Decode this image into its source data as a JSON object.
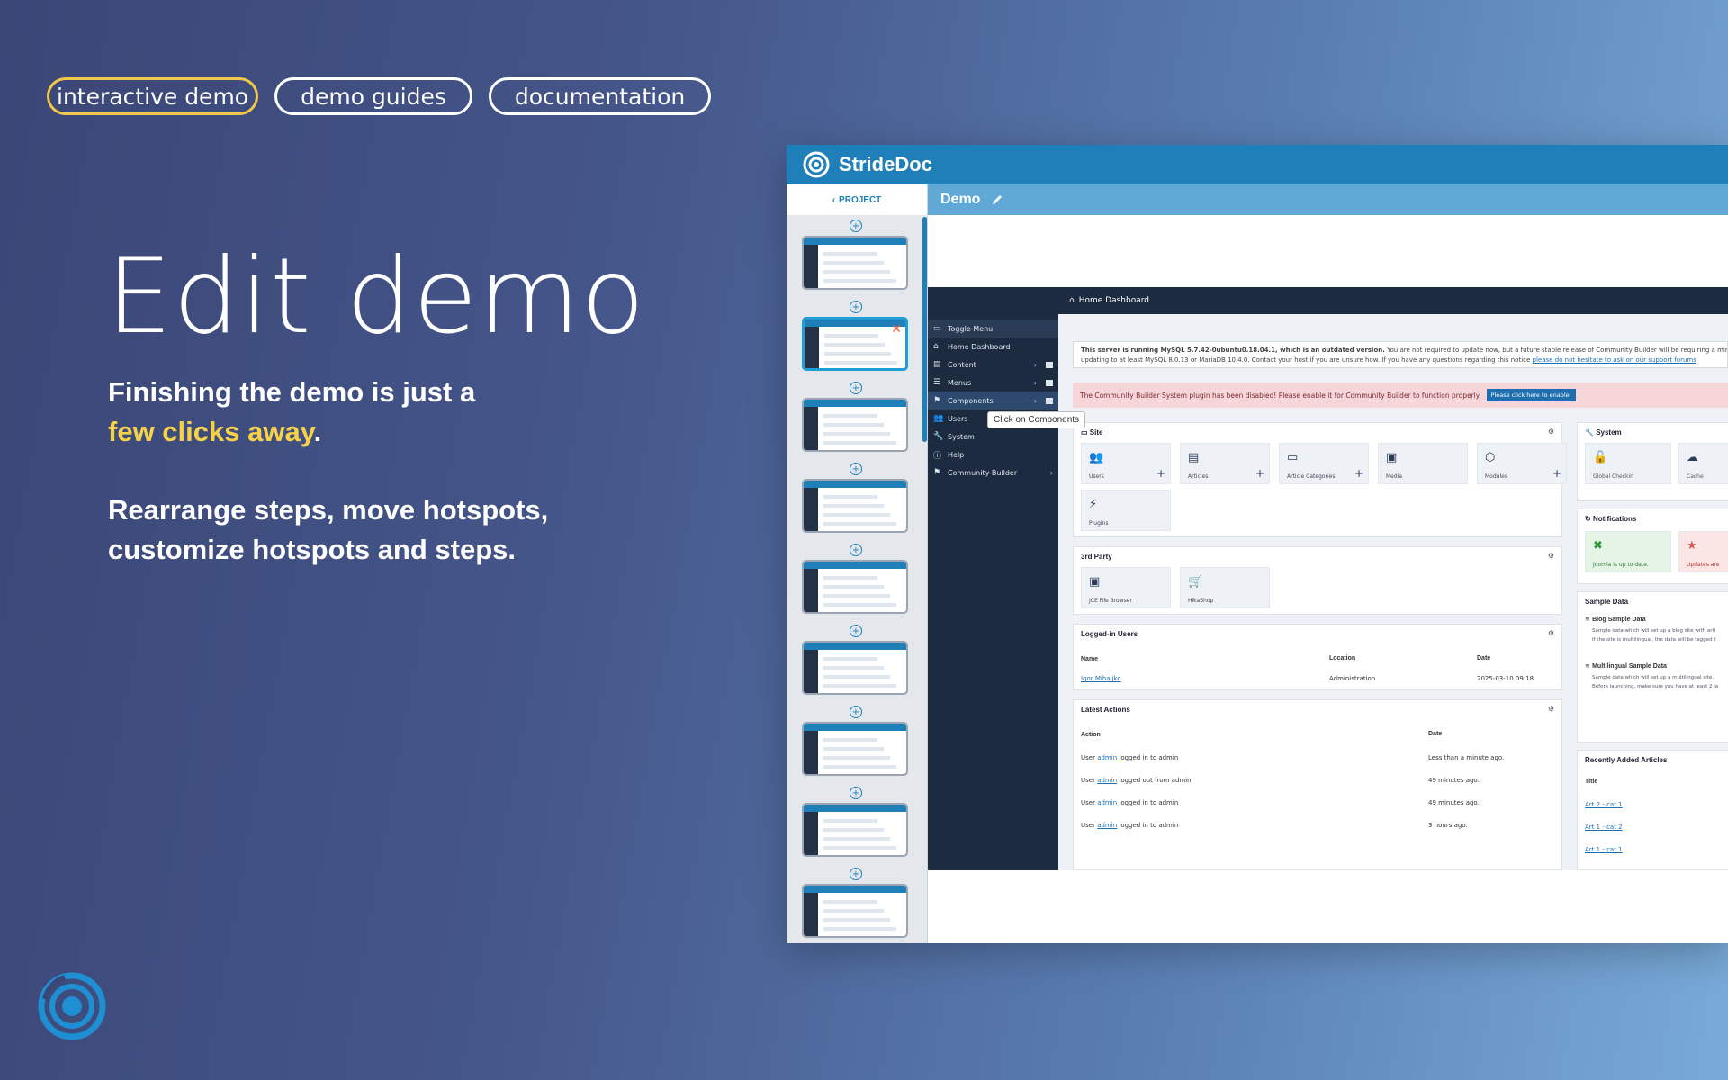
{
  "tabs": [
    "interactive demo",
    "demo guides",
    "documentation"
  ],
  "headline": "Edit demo",
  "subtitle1_a": "Finishing the demo is just a",
  "subtitle1_b": "few clicks away",
  "subtitle1_c": ".",
  "subtitle2_a": "Rearrange steps, move hotspots,",
  "subtitle2_b": "customize hotspots and steps.",
  "app": {
    "brand": "StrideDoc",
    "project_back": "PROJECT",
    "demo_title": "Demo",
    "step_count": 9
  },
  "screenshot": {
    "breadcrumb": "Home Dashboard",
    "nav": [
      "Toggle Menu",
      "Home Dashboard",
      "Content",
      "Menus",
      "Components",
      "Users",
      "System",
      "Help",
      "Community Builder"
    ],
    "tooltip": "Click on Components",
    "notice_bold": "This server is running MySQL 5.7.42-0ubuntu0.18.04.1, which is an outdated version.",
    "notice_rest": "You are not required to update now, but a future stable release of Community Builder will be requiring a minimum",
    "notice_line2": "updating to at least MySQL 8.0.13 or MariaDB 10.4.0. Contact your host if you are unsure how. If you have any questions regarding this notice",
    "notice_link": "please do not hesitate to ask on our support forums",
    "alert": "The Community Builder System plugin has been disabled! Please enable it for Community Builder to function properly.",
    "alert_button": "Please click here to enable.",
    "site_title": "Site",
    "site_tiles": [
      "Users",
      "Articles",
      "Article Categories",
      "Media",
      "Modules",
      "Plugins"
    ],
    "third_party_title": "3rd Party",
    "third_party_tiles": [
      "JCE File Browser",
      "HikaShop"
    ],
    "logged_title": "Logged-in Users",
    "logged_cols": [
      "Name",
      "Location",
      "Date"
    ],
    "logged_row": [
      "Igor Mihaljko",
      "Administration",
      "2025-03-10 09:18"
    ],
    "actions_title": "Latest Actions",
    "actions_cols": [
      "Action",
      "Date"
    ],
    "actions": [
      {
        "pre": "User",
        "user": "admin",
        "post": "logged in to admin",
        "date": "Less than a minute ago."
      },
      {
        "pre": "User",
        "user": "admin",
        "post": "logged out from admin",
        "date": "49 minutes ago."
      },
      {
        "pre": "User",
        "user": "admin",
        "post": "logged in to admin",
        "date": "49 minutes ago."
      },
      {
        "pre": "User",
        "user": "admin",
        "post": "logged in to admin",
        "date": "3 hours ago."
      }
    ],
    "system_title": "System",
    "system_tiles": [
      "Global Checkin",
      "Cache"
    ],
    "notif_title": "Notifications",
    "notif_tiles": [
      "Joomla is up to date.",
      "Updates are"
    ],
    "sample_title": "Sample Data",
    "sample_items": [
      {
        "title": "Blog Sample Data",
        "l1": "Sample data which will set up a blog site with arti",
        "l2": "If the site is multilingual, the data will be tagged t"
      },
      {
        "title": "Multilingual Sample Data",
        "l1": "Sample data which will set up a multilingual site.",
        "l2": "Before launching, make sure you have at least 2 la"
      }
    ],
    "recent_title": "Recently Added Articles",
    "recent_col": "Title",
    "recent_items": [
      "Art 2 - cat 1",
      "Art 1 - cat 2",
      "Art 1 - cat 1"
    ]
  },
  "colors": {
    "accent": "#f2c84b",
    "brand_blue": "#1f7fb9"
  }
}
